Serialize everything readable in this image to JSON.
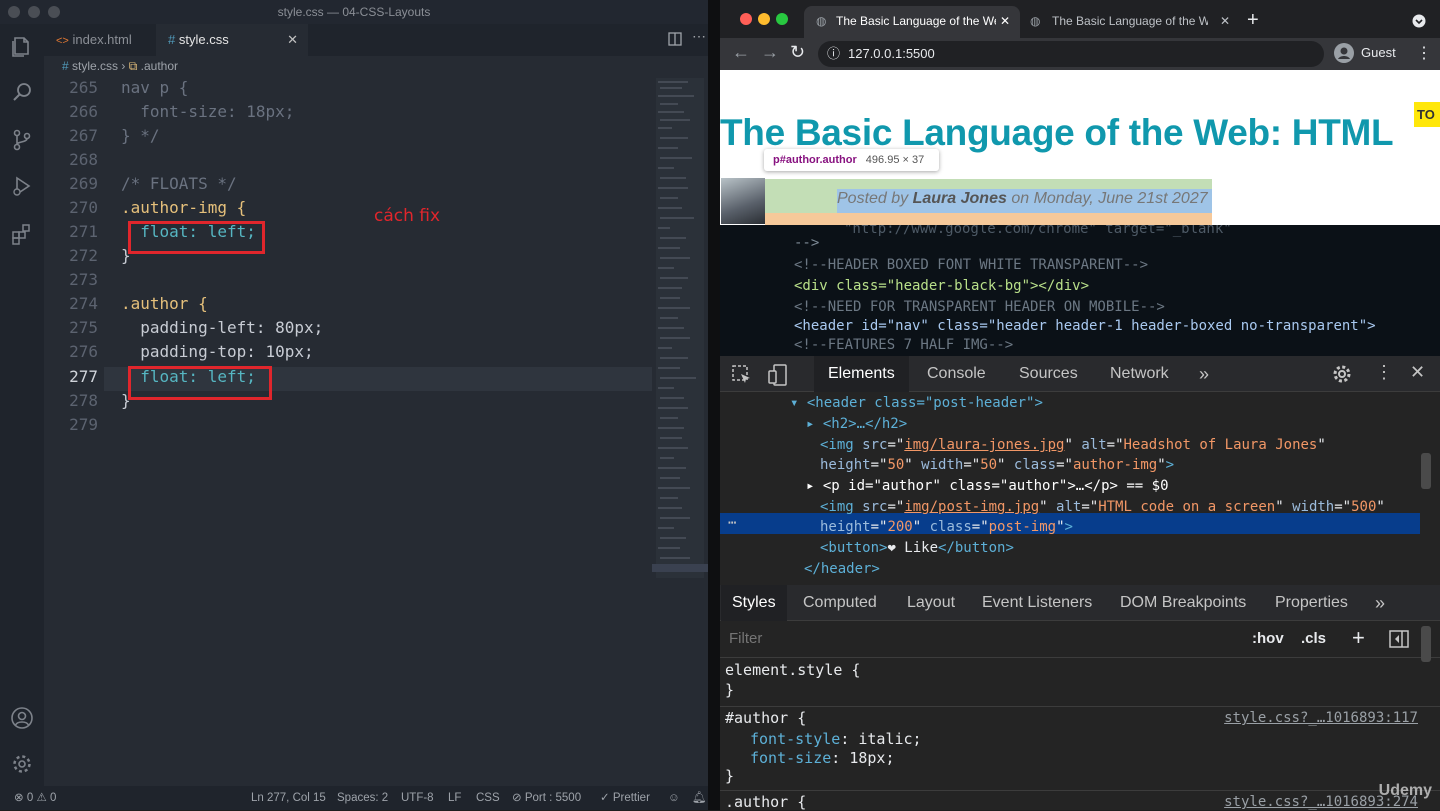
{
  "vscode": {
    "title": "style.css — 04-CSS-Layouts",
    "tabs": [
      {
        "label": "index.html",
        "icon": "html-file-icon"
      },
      {
        "label": "style.css",
        "icon": "css-file-icon"
      }
    ],
    "breadcrumb": {
      "file": "style.css",
      "symbol": ".author"
    },
    "lines": [
      {
        "num": "265",
        "text": "nav p {"
      },
      {
        "num": "266",
        "text": "  font-size: 18px;"
      },
      {
        "num": "267",
        "text": "} */"
      },
      {
        "num": "268",
        "text": ""
      },
      {
        "num": "269",
        "text": "/* FLOATS */"
      },
      {
        "num": "270",
        "text": ".author-img {"
      },
      {
        "num": "271",
        "text": "  float: left;"
      },
      {
        "num": "272",
        "text": "}"
      },
      {
        "num": "273",
        "text": ""
      },
      {
        "num": "274",
        "text": ".author {"
      },
      {
        "num": "275",
        "text": "  padding-left: 80px;"
      },
      {
        "num": "276",
        "text": "  padding-top: 10px;"
      },
      {
        "num": "277",
        "text": "  float: left;"
      },
      {
        "num": "278",
        "text": "}"
      },
      {
        "num": "279",
        "text": ""
      }
    ],
    "annotation": "cách fix",
    "status": {
      "problems": "0",
      "warnings": "0",
      "position": "Ln 277, Col 15",
      "spaces": "Spaces: 2",
      "encoding": "UTF-8",
      "eol": "LF",
      "language": "CSS",
      "port": "Port : 5500",
      "prettier": "Prettier"
    }
  },
  "chrome": {
    "tabs": [
      {
        "label": "The Basic Language of the Web"
      },
      {
        "label": "The Basic Language of the Web"
      }
    ],
    "url": "127.0.0.1:5500",
    "profile": "Guest",
    "page": {
      "heading": "The Basic Language of the Web: HTML",
      "tooltip_selector": "p#author.author",
      "tooltip_size": "496.95 × 37",
      "author_prefix": "Posted by ",
      "author_name": "Laura Jones",
      "author_suffix": " on Monday, June 21st 2027",
      "badge": "TO",
      "code_image_lines": [
        "\"http://www.google.com/chrome\" target=\"_blank\"",
        "-->",
        "<!--HEADER BOXED FONT WHITE TRANSPARENT-->",
        "<div class=\"header-black-bg\"></div>",
        "<!--NEED FOR TRANSPARENT HEADER ON MOBILE-->",
        "<header id=\"nav\" class=\"header header-1 header-boxed no-transparent\">",
        "<!--FEATURES 7 HALF IMG-->"
      ]
    },
    "devtools": {
      "tabs": [
        "Elements",
        "Console",
        "Sources",
        "Network"
      ],
      "dom": {
        "header_open": "<header class=\"post-header\">",
        "h2": "<h2>…</h2>",
        "img1_src": "img/laura-jones.jpg",
        "img1_alt": "Headshot of Laura Jones",
        "img1_height": "50",
        "img1_width": "50",
        "img1_class": "author-img",
        "p_id": "author",
        "p_class": "author",
        "p_marker": "== $0",
        "img2_src": "img/post-img.jpg",
        "img2_alt": "HTML code on a screen",
        "img2_width": "500",
        "img2_height": "200",
        "img2_class": "post-img",
        "button_text": "❤ Like",
        "header_close": "</header>"
      },
      "styles_tabs": [
        "Styles",
        "Computed",
        "Layout",
        "Event Listeners",
        "DOM Breakpoints",
        "Properties"
      ],
      "filter_placeholder": "Filter",
      "hov": ":hov",
      "cls": ".cls",
      "rules": [
        {
          "selector": "element.style {",
          "close": "}",
          "source": ""
        },
        {
          "selector": "#author {",
          "props": [
            {
              "name": "font-style",
              "value": "italic;"
            },
            {
              "name": "font-size",
              "value": "18px;"
            }
          ],
          "close": "}",
          "source": "style.css?_…1016893:117"
        },
        {
          "selector": ".author {",
          "source": "style.css?_…1016893:274"
        }
      ]
    }
  },
  "watermark": "Udemy"
}
